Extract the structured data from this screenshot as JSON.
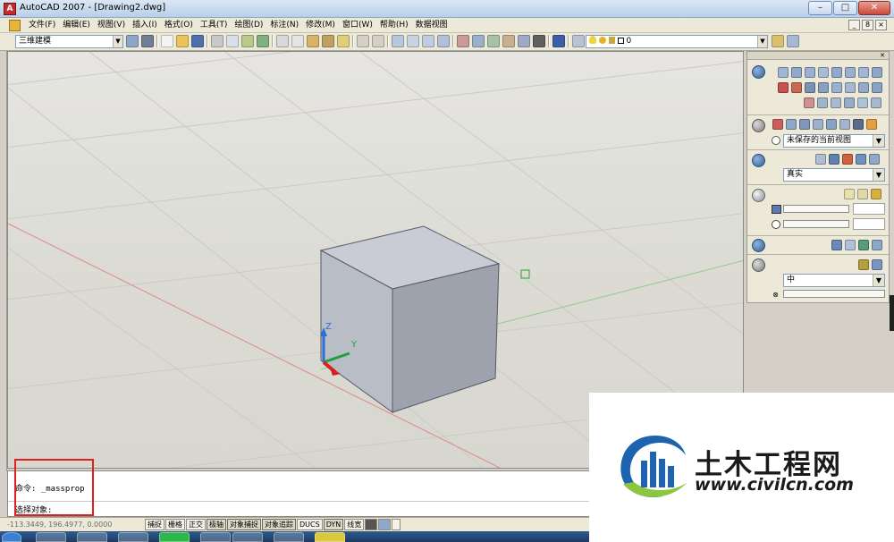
{
  "window": {
    "title": "AutoCAD 2007 - [Drawing2.dwg]",
    "app_icon_glyph": "A",
    "controls": [
      "–",
      "□",
      "✕"
    ]
  },
  "menu": {
    "items": [
      "文件(F)",
      "编辑(E)",
      "视图(V)",
      "插入(I)",
      "格式(O)",
      "工具(T)",
      "绘图(D)",
      "标注(N)",
      "修改(M)",
      "窗口(W)",
      "帮助(H)",
      "数据视图"
    ],
    "doc_controls": [
      "_",
      "8",
      "×"
    ]
  },
  "toolbar": {
    "workspace_value": "三维建模",
    "layer_value": "0"
  },
  "viewport": {
    "ucs_labels": {
      "z": "Z",
      "y": "Y"
    }
  },
  "right_panel": {
    "view_select": "未保存的当前视图",
    "visual_style_select": "真实",
    "material_select": "中"
  },
  "command": {
    "line1": "命令: _massprop",
    "line2": "选择对象:"
  },
  "status": {
    "coords": "-113.3449, 196.4977, 0.0000",
    "buttons": [
      "捕捉",
      "栅格",
      "正交",
      "极轴",
      "对象捕捉",
      "对象追踪",
      "DUCS",
      "DYN",
      "线宽"
    ]
  },
  "watermark": {
    "title": "土木工程网",
    "url": "www.civilcn.com"
  },
  "colors": {
    "highlight": "#e02020",
    "cube_front": "#b9bdc6",
    "cube_side": "#9ea2ad",
    "cube_top": "#c9ccd4",
    "x_axis_line": "#d97a7a",
    "y_axis_line": "#7fc77f"
  }
}
